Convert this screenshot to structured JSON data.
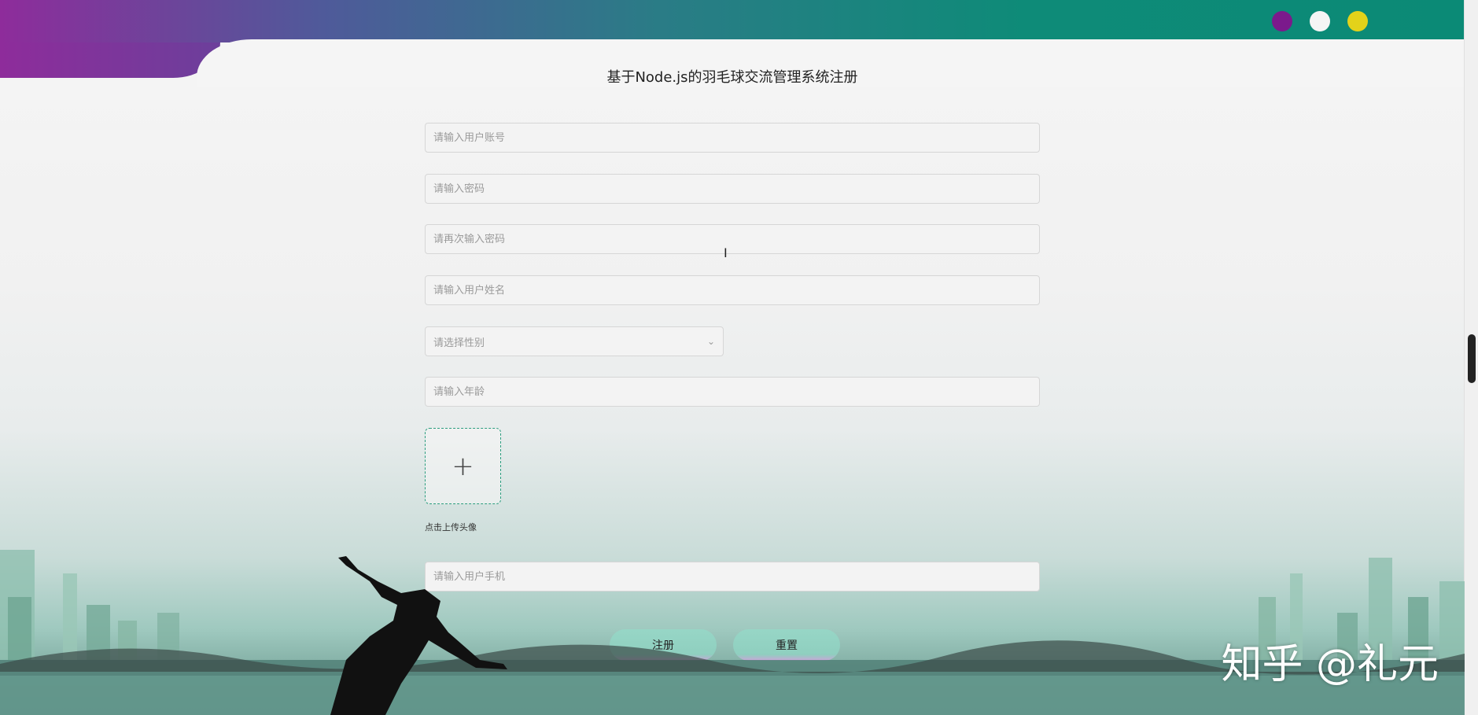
{
  "header": {
    "title": "基于Node.js的羽毛球交流管理系统注册",
    "dots": [
      {
        "name": "purple-dot",
        "color": "#7b1a8c"
      },
      {
        "name": "white-dot",
        "color": "#f5f5f5"
      },
      {
        "name": "yellow-dot",
        "color": "#e3d21a"
      }
    ]
  },
  "form": {
    "account_placeholder": "请输入用户账号",
    "password_placeholder": "请输入密码",
    "confirm_password_placeholder": "请再次输入密码",
    "name_placeholder": "请输入用户姓名",
    "gender_placeholder": "请选择性别",
    "age_placeholder": "请输入年龄",
    "avatar_upload_hint": "点击上传头像",
    "phone_placeholder": "请输入用户手机"
  },
  "buttons": {
    "register_label": "注册",
    "reset_label": "重置"
  },
  "watermark": "知乎 @礼元",
  "colors": {
    "accent": "#2a9d7e",
    "button": "#97d6c6"
  }
}
